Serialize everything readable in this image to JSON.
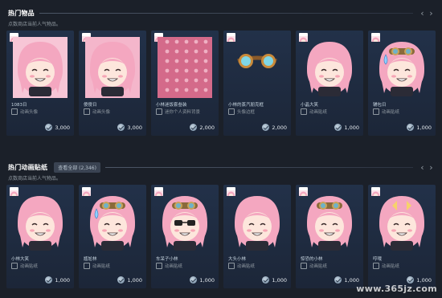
{
  "sections": [
    {
      "title": "热门物品",
      "subtitle": "点数商店当前人气物品。",
      "view_all": "",
      "prev_icon": "chevron-left-icon",
      "next_icon": "chevron-right-icon",
      "items": [
        {
          "name": "1083日",
          "type": "动画头像",
          "price": "3,000",
          "art": "face-pink-1"
        },
        {
          "name": "傻傻日",
          "type": "动画头像",
          "price": "3,000",
          "art": "face-pink-2"
        },
        {
          "name": "小林迷饭套叁装",
          "type": "迷你个人资料背景",
          "price": "2,000",
          "art": "pattern"
        },
        {
          "name": "小林的蒸汽朋克框",
          "type": "头像边框",
          "price": "2,000",
          "art": "goggles"
        },
        {
          "name": "小晶大笑",
          "type": "动画贴纸",
          "price": "1,000",
          "art": "sticker-1"
        },
        {
          "name": "辅包日",
          "type": "动画贴纸",
          "price": "1,000",
          "art": "sticker-2"
        }
      ]
    },
    {
      "title": "热门动画贴纸",
      "subtitle": "点数商店当前人气物品。",
      "view_all": "查看全部 (2,346)",
      "prev_icon": "chevron-left-icon",
      "next_icon": "chevron-right-icon",
      "items": [
        {
          "name": "小林大笑",
          "type": "动画贴纸",
          "price": "1,000",
          "art": "sticker-3"
        },
        {
          "name": "尴尬林",
          "type": "动画贴纸",
          "price": "1,000",
          "art": "sticker-4"
        },
        {
          "name": "车呆子小林",
          "type": "动画贴纸",
          "price": "1,000",
          "art": "sticker-5"
        },
        {
          "name": "大头小林",
          "type": "动画贴纸",
          "price": "1,000",
          "art": "sticker-6"
        },
        {
          "name": "惊恐的小林",
          "type": "动画贴纸",
          "price": "1,000",
          "art": "sticker-7"
        },
        {
          "name": "哼哦",
          "type": "动画贴纸",
          "price": "1,000",
          "art": "sticker-8"
        }
      ]
    }
  ],
  "watermark": "www.365jz.com",
  "colors": {
    "background": "#1b2029",
    "card": "#1f2b3e",
    "hair_pink": "#f4a7c0",
    "text_primary": "#c7d5e0",
    "text_secondary": "#8f98a0"
  }
}
